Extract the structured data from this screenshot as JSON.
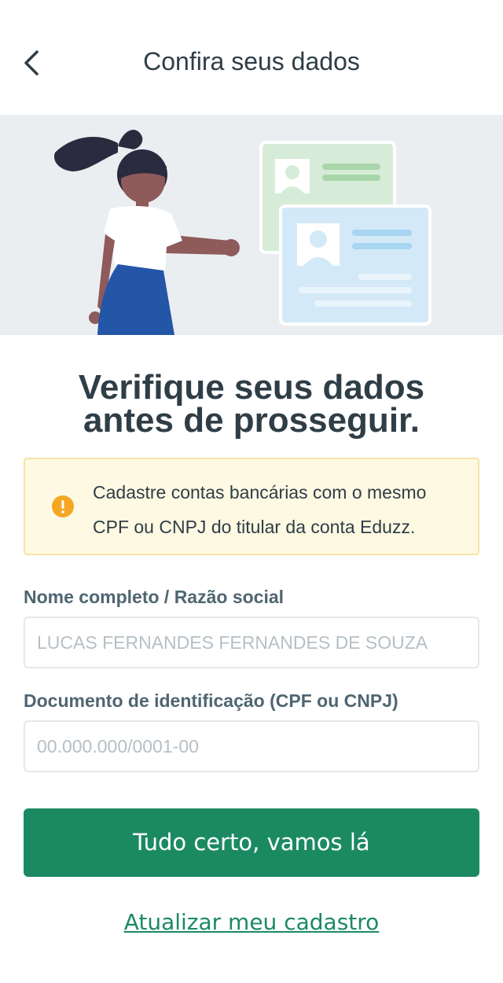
{
  "header": {
    "back_icon": "chevron-left-icon",
    "title": "Confira seus dados"
  },
  "main": {
    "heading_line1": "Verifique seus dados",
    "heading_line2": "antes de prosseguir.",
    "alert": {
      "icon": "warning-icon",
      "text": "Cadastre contas bancárias com o mesmo CPF ou CNPJ do titular da conta Eduzz."
    },
    "fields": {
      "name": {
        "label": "Nome completo / Razão social",
        "placeholder": "LUCAS FERNANDES FERNANDES DE SOUZA",
        "value": ""
      },
      "document": {
        "label": "Documento de identificação (CPF ou CNPJ)",
        "placeholder": "00.000.000/0001-00",
        "value": ""
      }
    },
    "primary_button": "Tudo certo, vamos lá",
    "secondary_link": "Atualizar meu cadastro"
  },
  "colors": {
    "primary": "#1b8a62",
    "text": "#2f3d46",
    "alert_bg": "#fef9e3",
    "alert_icon": "#f5a623"
  }
}
